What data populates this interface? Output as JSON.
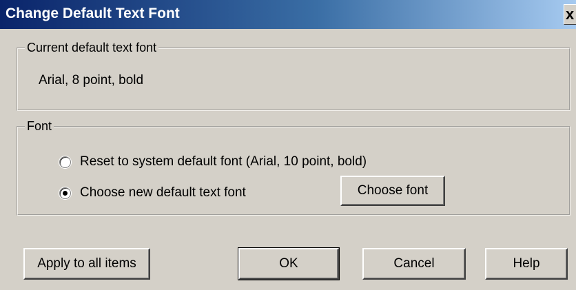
{
  "window": {
    "title": "Change Default Text Font",
    "close_glyph": "x"
  },
  "current_font_group": {
    "legend": "Current default text font",
    "value": "Arial, 8 point, bold"
  },
  "font_group": {
    "legend": "Font",
    "options": [
      {
        "label": "Reset to system default font (Arial, 10 point, bold)",
        "selected": false
      },
      {
        "label": "Choose new default text font",
        "selected": true
      }
    ],
    "choose_font_button": "Choose font"
  },
  "buttons": {
    "apply_all": "Apply to all items",
    "ok": "OK",
    "cancel": "Cancel",
    "help": "Help"
  },
  "colors": {
    "dialog_bg": "#d4d0c8",
    "title_gradient_start": "#0a246a",
    "title_gradient_end": "#a6caf0",
    "title_text": "#ffffff"
  }
}
